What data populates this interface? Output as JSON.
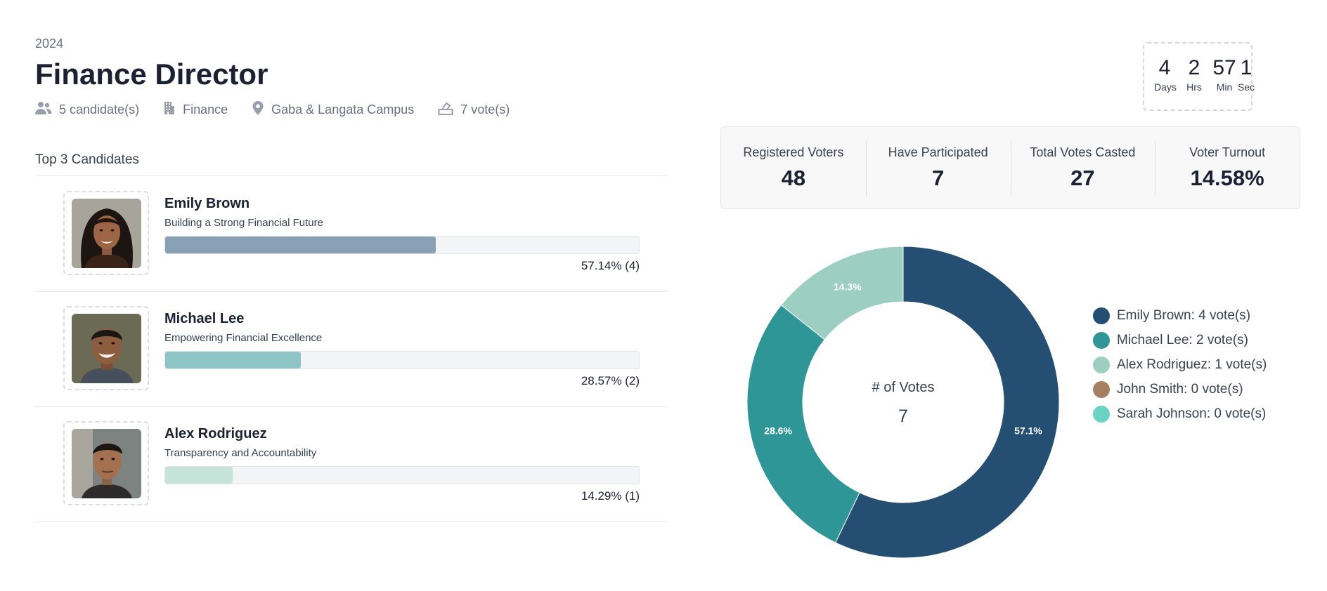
{
  "header": {
    "year": "2024",
    "title": "Finance Director",
    "meta": {
      "candidates": "5 candidate(s)",
      "department": "Finance",
      "location": "Gaba & Langata Campus",
      "votes": "7 vote(s)"
    }
  },
  "countdown": {
    "days": {
      "value": "4",
      "label": "Days"
    },
    "hours": {
      "value": "2",
      "label": "Hrs"
    },
    "minutes": {
      "value": "57",
      "label": "Min"
    },
    "seconds": {
      "value": "1",
      "label": "Sec"
    }
  },
  "stats": [
    {
      "label": "Registered Voters",
      "value": "48"
    },
    {
      "label": "Have Participated",
      "value": "7"
    },
    {
      "label": "Total Votes Casted",
      "value": "27"
    },
    {
      "label": "Voter Turnout",
      "value": "14.58%"
    }
  ],
  "top_candidates": {
    "title": "Top 3 Candidates",
    "items": [
      {
        "name": "Emily Brown",
        "slogan": "Building a Strong Financial Future",
        "percent_label": "57.14% (4)",
        "fraction": 0.5714,
        "color": "#8aa0b4"
      },
      {
        "name": "Michael Lee",
        "slogan": "Empowering Financial Excellence",
        "percent_label": "28.57% (2)",
        "fraction": 0.2857,
        "color": "#8ec5c5"
      },
      {
        "name": "Alex Rodriguez",
        "slogan": "Transparency and Accountability",
        "percent_label": "14.29% (1)",
        "fraction": 0.1429,
        "color": "#c6e3da"
      }
    ]
  },
  "chart_data": {
    "type": "pie",
    "center_label": "# of Votes",
    "center_value": "7",
    "categories": [
      "Emily Brown",
      "Michael Lee",
      "Alex Rodriguez",
      "John Smith",
      "Sarah Johnson"
    ],
    "values": [
      4,
      2,
      1,
      0,
      0
    ],
    "slice_labels": [
      "57.1%",
      "28.6%",
      "14.3%",
      "",
      ""
    ],
    "colors": [
      "#244f72",
      "#2e9696",
      "#9ccfc2",
      "#a57f60",
      "#68d3c4"
    ],
    "legend": [
      "Emily Brown: 4 vote(s)",
      "Michael Lee: 2 vote(s)",
      "Alex Rodriguez: 1 vote(s)",
      "John Smith: 0 vote(s)",
      "Sarah Johnson: 0 vote(s)"
    ],
    "legend_position": "right"
  }
}
